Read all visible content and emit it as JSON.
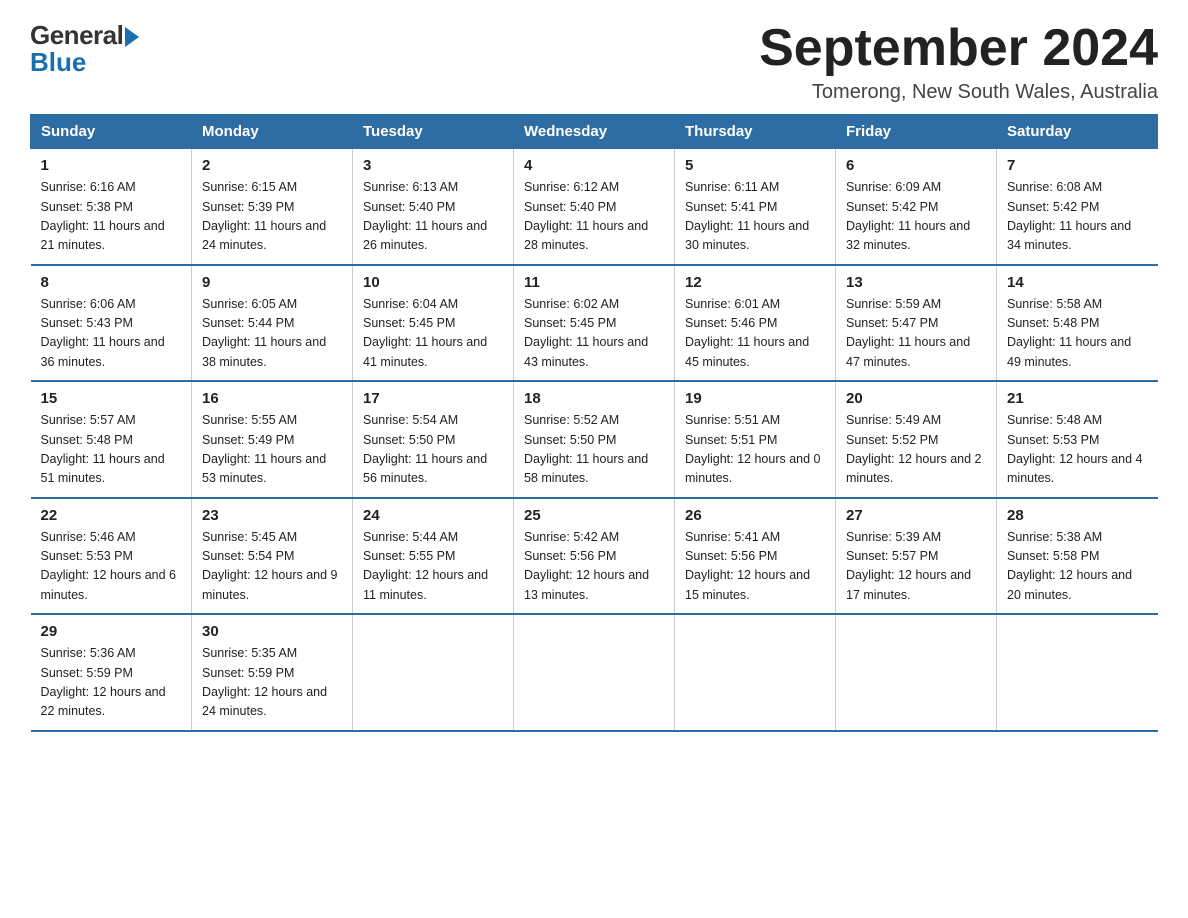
{
  "header": {
    "logo_general": "General",
    "logo_blue": "Blue",
    "main_title": "September 2024",
    "subtitle": "Tomerong, New South Wales, Australia"
  },
  "days_of_week": [
    "Sunday",
    "Monday",
    "Tuesday",
    "Wednesday",
    "Thursday",
    "Friday",
    "Saturday"
  ],
  "weeks": [
    [
      {
        "day": "1",
        "sunrise": "6:16 AM",
        "sunset": "5:38 PM",
        "daylight": "11 hours and 21 minutes."
      },
      {
        "day": "2",
        "sunrise": "6:15 AM",
        "sunset": "5:39 PM",
        "daylight": "11 hours and 24 minutes."
      },
      {
        "day": "3",
        "sunrise": "6:13 AM",
        "sunset": "5:40 PM",
        "daylight": "11 hours and 26 minutes."
      },
      {
        "day": "4",
        "sunrise": "6:12 AM",
        "sunset": "5:40 PM",
        "daylight": "11 hours and 28 minutes."
      },
      {
        "day": "5",
        "sunrise": "6:11 AM",
        "sunset": "5:41 PM",
        "daylight": "11 hours and 30 minutes."
      },
      {
        "day": "6",
        "sunrise": "6:09 AM",
        "sunset": "5:42 PM",
        "daylight": "11 hours and 32 minutes."
      },
      {
        "day": "7",
        "sunrise": "6:08 AM",
        "sunset": "5:42 PM",
        "daylight": "11 hours and 34 minutes."
      }
    ],
    [
      {
        "day": "8",
        "sunrise": "6:06 AM",
        "sunset": "5:43 PM",
        "daylight": "11 hours and 36 minutes."
      },
      {
        "day": "9",
        "sunrise": "6:05 AM",
        "sunset": "5:44 PM",
        "daylight": "11 hours and 38 minutes."
      },
      {
        "day": "10",
        "sunrise": "6:04 AM",
        "sunset": "5:45 PM",
        "daylight": "11 hours and 41 minutes."
      },
      {
        "day": "11",
        "sunrise": "6:02 AM",
        "sunset": "5:45 PM",
        "daylight": "11 hours and 43 minutes."
      },
      {
        "day": "12",
        "sunrise": "6:01 AM",
        "sunset": "5:46 PM",
        "daylight": "11 hours and 45 minutes."
      },
      {
        "day": "13",
        "sunrise": "5:59 AM",
        "sunset": "5:47 PM",
        "daylight": "11 hours and 47 minutes."
      },
      {
        "day": "14",
        "sunrise": "5:58 AM",
        "sunset": "5:48 PM",
        "daylight": "11 hours and 49 minutes."
      }
    ],
    [
      {
        "day": "15",
        "sunrise": "5:57 AM",
        "sunset": "5:48 PM",
        "daylight": "11 hours and 51 minutes."
      },
      {
        "day": "16",
        "sunrise": "5:55 AM",
        "sunset": "5:49 PM",
        "daylight": "11 hours and 53 minutes."
      },
      {
        "day": "17",
        "sunrise": "5:54 AM",
        "sunset": "5:50 PM",
        "daylight": "11 hours and 56 minutes."
      },
      {
        "day": "18",
        "sunrise": "5:52 AM",
        "sunset": "5:50 PM",
        "daylight": "11 hours and 58 minutes."
      },
      {
        "day": "19",
        "sunrise": "5:51 AM",
        "sunset": "5:51 PM",
        "daylight": "12 hours and 0 minutes."
      },
      {
        "day": "20",
        "sunrise": "5:49 AM",
        "sunset": "5:52 PM",
        "daylight": "12 hours and 2 minutes."
      },
      {
        "day": "21",
        "sunrise": "5:48 AM",
        "sunset": "5:53 PM",
        "daylight": "12 hours and 4 minutes."
      }
    ],
    [
      {
        "day": "22",
        "sunrise": "5:46 AM",
        "sunset": "5:53 PM",
        "daylight": "12 hours and 6 minutes."
      },
      {
        "day": "23",
        "sunrise": "5:45 AM",
        "sunset": "5:54 PM",
        "daylight": "12 hours and 9 minutes."
      },
      {
        "day": "24",
        "sunrise": "5:44 AM",
        "sunset": "5:55 PM",
        "daylight": "12 hours and 11 minutes."
      },
      {
        "day": "25",
        "sunrise": "5:42 AM",
        "sunset": "5:56 PM",
        "daylight": "12 hours and 13 minutes."
      },
      {
        "day": "26",
        "sunrise": "5:41 AM",
        "sunset": "5:56 PM",
        "daylight": "12 hours and 15 minutes."
      },
      {
        "day": "27",
        "sunrise": "5:39 AM",
        "sunset": "5:57 PM",
        "daylight": "12 hours and 17 minutes."
      },
      {
        "day": "28",
        "sunrise": "5:38 AM",
        "sunset": "5:58 PM",
        "daylight": "12 hours and 20 minutes."
      }
    ],
    [
      {
        "day": "29",
        "sunrise": "5:36 AM",
        "sunset": "5:59 PM",
        "daylight": "12 hours and 22 minutes."
      },
      {
        "day": "30",
        "sunrise": "5:35 AM",
        "sunset": "5:59 PM",
        "daylight": "12 hours and 24 minutes."
      },
      null,
      null,
      null,
      null,
      null
    ]
  ]
}
